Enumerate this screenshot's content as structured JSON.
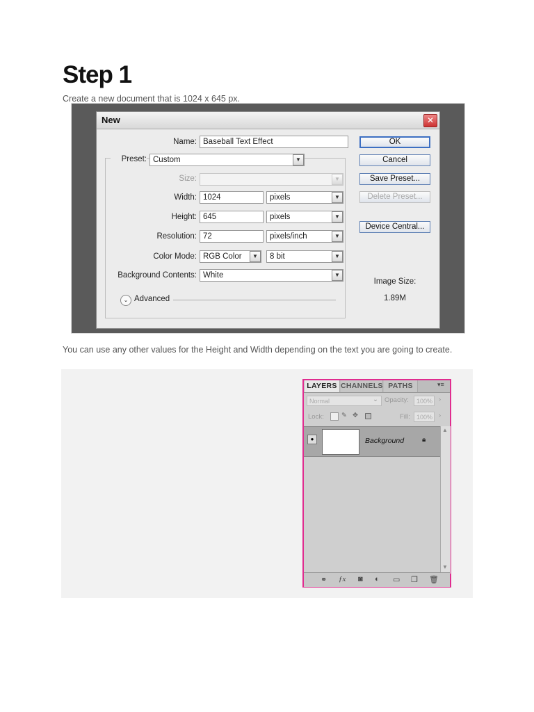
{
  "title": "Step 1",
  "paragraph1": "Create a new document that is 1024 x 645 px.",
  "paragraph2": "You can use any other values for the Height and Width depending on the text you are going to create.",
  "dialog": {
    "title": "New",
    "close": "✕",
    "name_label": "Name:",
    "name_value": "Baseball Text Effect",
    "preset_label": "Preset:",
    "preset_value": "Custom",
    "size_label": "Size:",
    "width_label": "Width:",
    "width_value": "1024",
    "width_unit": "pixels",
    "height_label": "Height:",
    "height_value": "645",
    "height_unit": "pixels",
    "resolution_label": "Resolution:",
    "resolution_value": "72",
    "resolution_unit": "pixels/inch",
    "color_mode_label": "Color Mode:",
    "color_mode_value": "RGB Color",
    "bit_depth_value": "8 bit",
    "background_label": "Background Contents:",
    "background_value": "White",
    "advanced_label": "Advanced",
    "ok": "OK",
    "cancel": "Cancel",
    "save_preset": "Save Preset...",
    "delete_preset": "Delete Preset...",
    "device_central": "Device Central...",
    "image_size_label": "Image Size:",
    "image_size_value": "1.89M"
  },
  "layers_panel": {
    "tabs": [
      "LAYERS",
      "CHANNELS",
      "PATHS"
    ],
    "menu": "▾≡",
    "blend_mode": "Normal",
    "opacity_label": "Opacity:",
    "opacity_value": "100%",
    "lock_label": "Lock:",
    "fill_label": "Fill:",
    "fill_value": "100%",
    "layer_name": "Background",
    "accent": "#e02c8f"
  }
}
